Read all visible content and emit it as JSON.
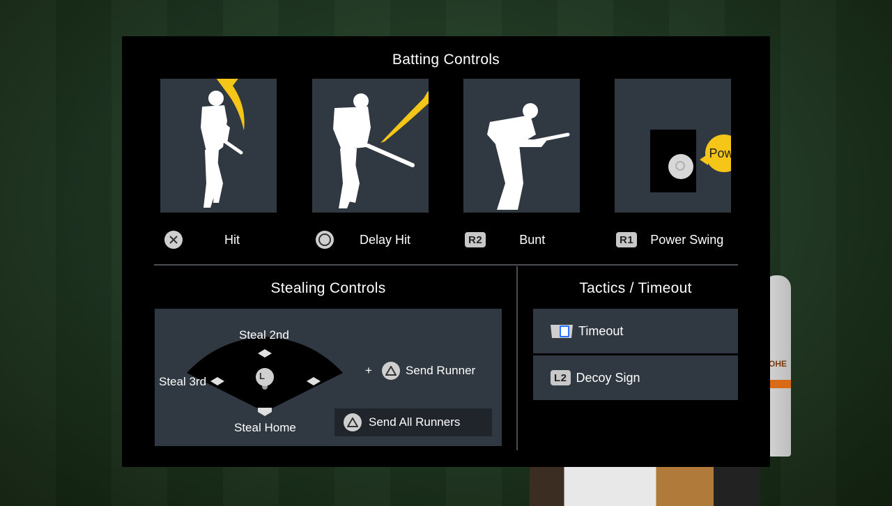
{
  "batting": {
    "title": "Batting Controls",
    "tiles": [
      {
        "button": "cross",
        "label": "Hit"
      },
      {
        "button": "circle",
        "label": "Delay Hit"
      },
      {
        "button": "R2",
        "label": "Bunt"
      },
      {
        "button": "R1",
        "label": "Power Swing",
        "badge": "Power"
      }
    ]
  },
  "stealing": {
    "title": "Stealing Controls",
    "steal_2nd": "Steal 2nd",
    "steal_3rd": "Steal 3rd",
    "steal_home": "Steal Home",
    "stick_label": "L",
    "plus": "+",
    "send_runner": "Send Runner",
    "send_all": "Send All Runners"
  },
  "tactics": {
    "title": "Tactics / Timeout",
    "timeout": "Timeout",
    "decoy_button": "L2",
    "decoy": "Decoy Sign"
  },
  "background": {
    "jersey_text": "OHE"
  },
  "colors": {
    "accent": "#f5c518",
    "tile": "#303841",
    "panel": "#000000"
  }
}
